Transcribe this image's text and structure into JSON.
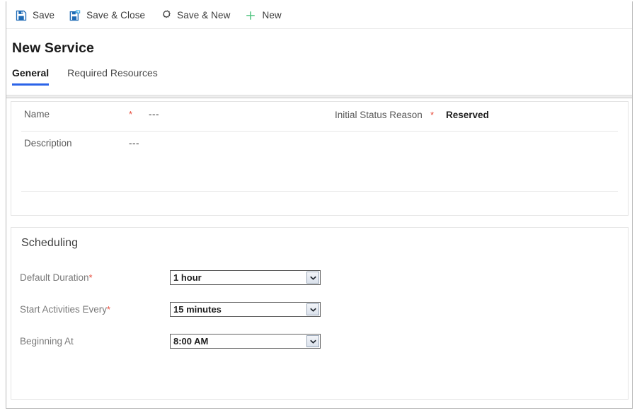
{
  "command_bar": {
    "buttons": [
      {
        "label": "Save",
        "icon": "save-icon"
      },
      {
        "label": "Save & Close",
        "icon": "save-and-close-icon"
      },
      {
        "label": "Save & New",
        "icon": "save-and-new-icon"
      },
      {
        "label": "New",
        "icon": "plus-icon"
      }
    ]
  },
  "page": {
    "title": "New Service"
  },
  "tabs": [
    {
      "label": "General",
      "active": true
    },
    {
      "label": "Required Resources",
      "active": false
    }
  ],
  "general_section": {
    "fields": [
      {
        "label": "Name",
        "required": true,
        "value": "---",
        "star": "*"
      },
      {
        "label": "Initial Status Reason",
        "required": true,
        "value": "Reserved",
        "star": "*"
      },
      {
        "label": "Description",
        "required": false,
        "value": "---",
        "star": ""
      }
    ]
  },
  "scheduling_section": {
    "heading": "Scheduling",
    "fields": [
      {
        "label": "Default Duration",
        "star": "*",
        "value": "1 hour"
      },
      {
        "label": "Start Activities Every",
        "star": "*",
        "value": "15 minutes"
      },
      {
        "label": "Beginning At",
        "star": "",
        "value": "8:00 AM"
      }
    ]
  },
  "colors": {
    "accent": "#2b63e8",
    "required": "#e74c3c",
    "save_icon": "#1d6ab5",
    "new_icon": "#4fc47f",
    "text": "#333333"
  }
}
